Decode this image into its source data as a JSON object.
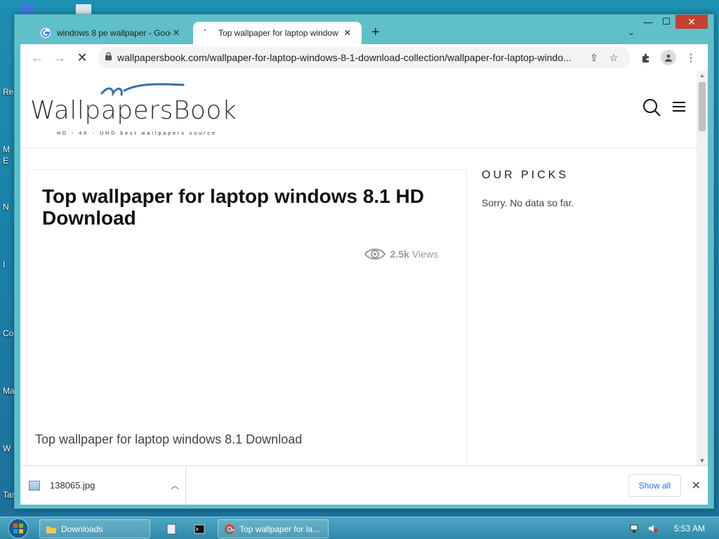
{
  "desktop": {
    "partial_labels": [
      "Re",
      "M",
      "E",
      "N",
      "I",
      "Co",
      "Ma",
      "W",
      "Tas"
    ]
  },
  "browser": {
    "tabs": [
      {
        "title": "windows 8 pe wallpaper - Google",
        "favicon": "google-icon",
        "active": false
      },
      {
        "title": "Top wallpaper for laptop window",
        "favicon": "loading-icon",
        "active": true
      }
    ],
    "new_tab": "+",
    "url": "wallpapersbook.com/wallpaper-for-laptop-windows-8-1-download-collection/wallpaper-for-laptop-windo...",
    "window_controls": {
      "minimize": "—",
      "maximize": "☐",
      "close": "✕"
    }
  },
  "page": {
    "logo_text": "WallpapersBook",
    "logo_tagline": "HD - 4K - UHD best wallpapers source",
    "article": {
      "title": "Top wallpaper for laptop windows 8.1 HD Download",
      "views_count": "2.5k",
      "views_label": "Views",
      "caption": "Top wallpaper for laptop windows 8.1 Download"
    },
    "sidebar": {
      "title": "OUR PICKS",
      "empty_message": "Sorry. No data so far."
    }
  },
  "downloads": {
    "file_name": "138065.jpg",
    "show_all": "Show all"
  },
  "taskbar": {
    "items": [
      {
        "label": "Downloads"
      },
      {
        "label": "Top wallpaper for la..."
      }
    ],
    "clock": "5:53 AM"
  },
  "colors": {
    "window_frame": "#5fc0c9",
    "close_button": "#c7402f",
    "link_blue": "#1a73e8",
    "logo_blue": "#3a6ea5"
  }
}
